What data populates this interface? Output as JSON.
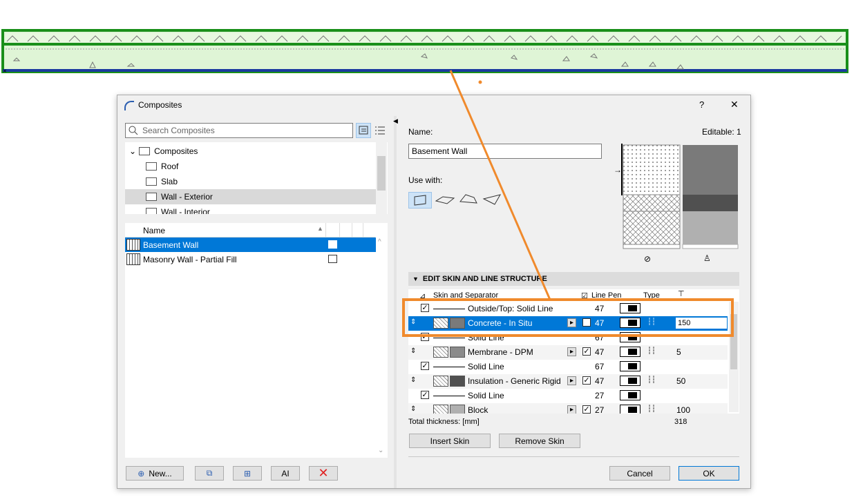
{
  "dialog": {
    "title": "Composites",
    "help_label": "?",
    "close_label": "✕"
  },
  "search": {
    "placeholder": "Search Composites"
  },
  "tree": {
    "root": "Composites",
    "folders": [
      "Roof",
      "Slab",
      "Wall - Exterior",
      "Wall - Interior"
    ],
    "selected": "Wall - Exterior"
  },
  "list": {
    "header_name": "Name",
    "items": [
      {
        "name": "Basement Wall",
        "selected": true
      },
      {
        "name": "Masonry Wall - Partial Fill",
        "selected": false
      }
    ]
  },
  "bottom_buttons": {
    "new_label": "New..."
  },
  "props": {
    "name_label": "Name:",
    "editable_label": "Editable: 1",
    "name_value": "Basement Wall",
    "use_with_label": "Use with:"
  },
  "section": {
    "title": "EDIT SKIN AND LINE STRUCTURE"
  },
  "skin_table": {
    "columns": {
      "skin": "Skin and Separator",
      "line_pen": "Line Pen",
      "type": "Type"
    },
    "rows": [
      {
        "kind": "line",
        "label": "Outside/Top: Solid Line",
        "pen": "47",
        "thickness": ""
      },
      {
        "kind": "skin",
        "label": "Concrete - In Situ",
        "pen": "47",
        "thickness": "150",
        "selected": true
      },
      {
        "kind": "line",
        "label": "Solid Line",
        "pen": "67",
        "thickness": ""
      },
      {
        "kind": "skin",
        "label": "Membrane - DPM",
        "pen": "47",
        "thickness": "5"
      },
      {
        "kind": "line",
        "label": "Solid Line",
        "pen": "67",
        "thickness": ""
      },
      {
        "kind": "skin",
        "label": "Insulation - Generic Rigid",
        "pen": "47",
        "thickness": "50"
      },
      {
        "kind": "line",
        "label": "Solid Line",
        "pen": "27",
        "thickness": ""
      },
      {
        "kind": "skin",
        "label": "Block",
        "pen": "27",
        "thickness": "100"
      }
    ],
    "total_label": "Total thickness: [mm]",
    "total_value": "318"
  },
  "skin_buttons": {
    "insert_label": "Insert Skin",
    "remove_label": "Remove Skin"
  },
  "footer": {
    "cancel_label": "Cancel",
    "ok_label": "OK"
  },
  "colors": {
    "accent": "#0078d7",
    "highlight": "#f08a2c",
    "wall_green": "#2a9d2a"
  }
}
